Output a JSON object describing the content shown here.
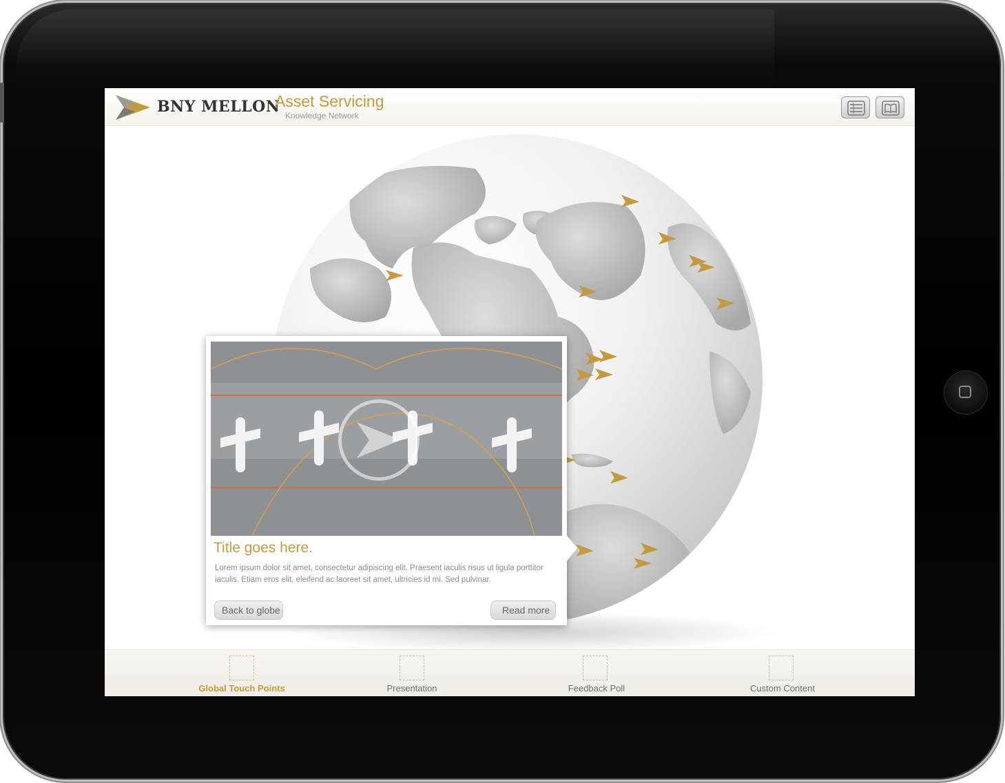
{
  "header": {
    "brand": "BNY MELLON",
    "product": "Asset Servicing",
    "product_sub": "Knowledge Network",
    "list_icon": "list-icon",
    "book_icon": "book-icon"
  },
  "card": {
    "title": "Title goes here.",
    "body": "Lorem ipsum dolor sit amet, consectetur adipiscing elit. Praesent iaculis risus ut ligula porttitor iaculis. Etiam eros elit, eleifend ac laoreet sit amet, ultricies id mi. Sed pulvinar.",
    "back_label": "Back to globe",
    "read_more_label": "Read more",
    "media_icon": "play-icon"
  },
  "tabs": [
    {
      "label": "Global Touch Points",
      "active": true
    },
    {
      "label": "Presentation",
      "active": false
    },
    {
      "label": "Feedback Poll",
      "active": false
    },
    {
      "label": "Custom Content",
      "active": false
    }
  ],
  "colors": {
    "accent": "#c39a3e",
    "text_muted": "#8a8a8a",
    "bezel": "#000000"
  }
}
